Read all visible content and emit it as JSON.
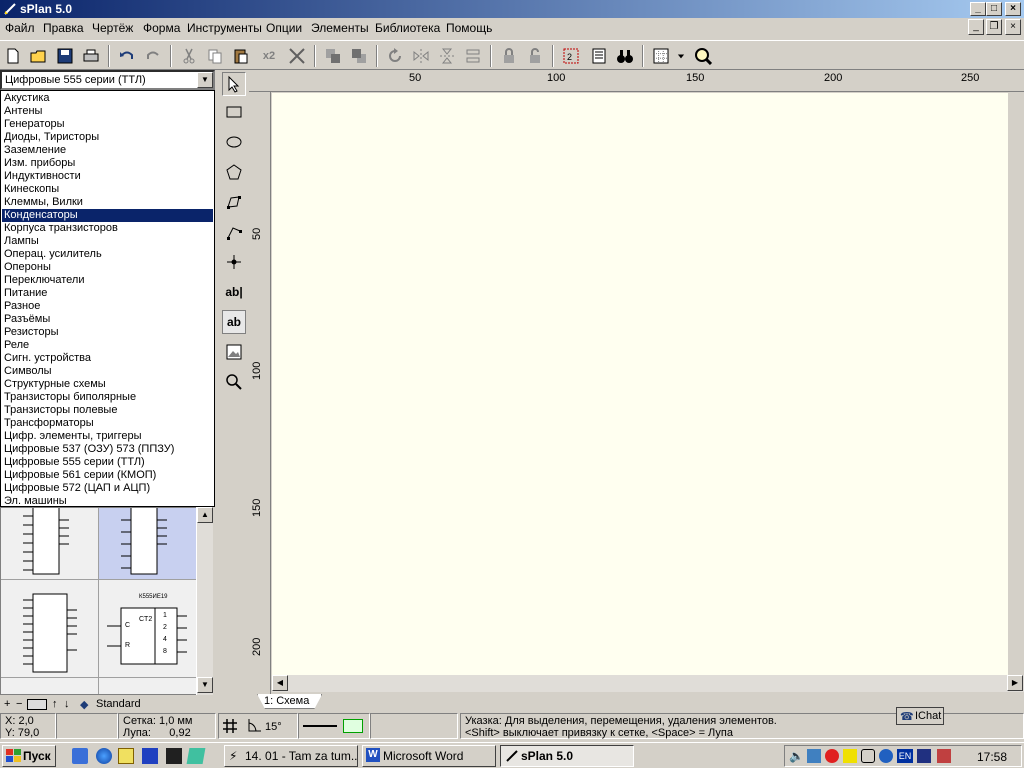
{
  "window": {
    "title": "sPlan 5.0",
    "min": "_",
    "max": "□",
    "close": "×"
  },
  "menu": [
    "Файл",
    "Правка",
    "Чертёж",
    "Форма",
    "Инструменты",
    "Опции",
    "Элементы",
    "Библиотека",
    "Помощь"
  ],
  "toolbar": {
    "dup_label": "x2"
  },
  "library": {
    "selected": "Цифровые 555 серии (ТТЛ)",
    "items": [
      "Акустика",
      "Антены",
      "Генераторы",
      "Диоды, Тиристоры",
      "Заземление",
      "Изм. приборы",
      "Индуктивности",
      "Кинескопы",
      "Клеммы, Вилки",
      "Конденсаторы",
      "Корпуса транзисторов",
      "Лампы",
      "Операц. усилитель",
      "Опероны",
      "Переключатели",
      "Питание",
      "Разное",
      "Разъёмы",
      "Резисторы",
      "Реле",
      "Сигн. устройства",
      "Символы",
      "Структурные схемы",
      "Транзисторы биполярные",
      "Транзисторы полевые",
      "Трансформаторы",
      "Цифр. элементы, триггеры",
      "Цифровые 537 (ОЗУ) 573 (ППЗУ)",
      "Цифровые 555 серии (ТТЛ)",
      "Цифровые 561 серии (КМОП)",
      "Цифровые 572 (ЦАП и АЦП)",
      "Эл. машины"
    ],
    "highlighted_index": 9,
    "footer": {
      "plus": "+",
      "minus": "−",
      "up": "↑",
      "down": "↓",
      "set": "Standard"
    },
    "preview_labels": {
      "chip_name": "К555ИЕ19",
      "ct": "CT2",
      "c": "C",
      "r": "R",
      "pins": [
        "1",
        "2",
        "4",
        "8"
      ]
    }
  },
  "palette_labels": {
    "text_tool": "ab|",
    "text_box_tool": "ab"
  },
  "rulers": {
    "top": [
      "50",
      "100",
      "150",
      "200",
      "250"
    ],
    "left": [
      "50",
      "100",
      "150",
      "200"
    ]
  },
  "tabs": [
    {
      "label": "1: Схема"
    }
  ],
  "status": {
    "x": "X: 2,0",
    "y": "Y: 79,0",
    "grid": "Сетка: 1,0 мм",
    "zoom": "Лупа:      0,92",
    "angle": "15°",
    "hint1": "Указка: Для выделения, перемещения, удаления элементов.",
    "hint2": "<Shift> выключает привязку к сетке, <Space> = Лупа"
  },
  "ichat": "IChat",
  "taskbar": {
    "start": "Пуск",
    "tasks": [
      {
        "label": "14. 01 - Tam za tum..."
      },
      {
        "label": "Microsoft Word"
      },
      {
        "label": "sPlan 5.0"
      }
    ],
    "lang": "EN",
    "clock": "17:58"
  },
  "colors": {
    "selection": "#0a246a",
    "canvas": "#fffff0",
    "face": "#d4d0c8"
  }
}
